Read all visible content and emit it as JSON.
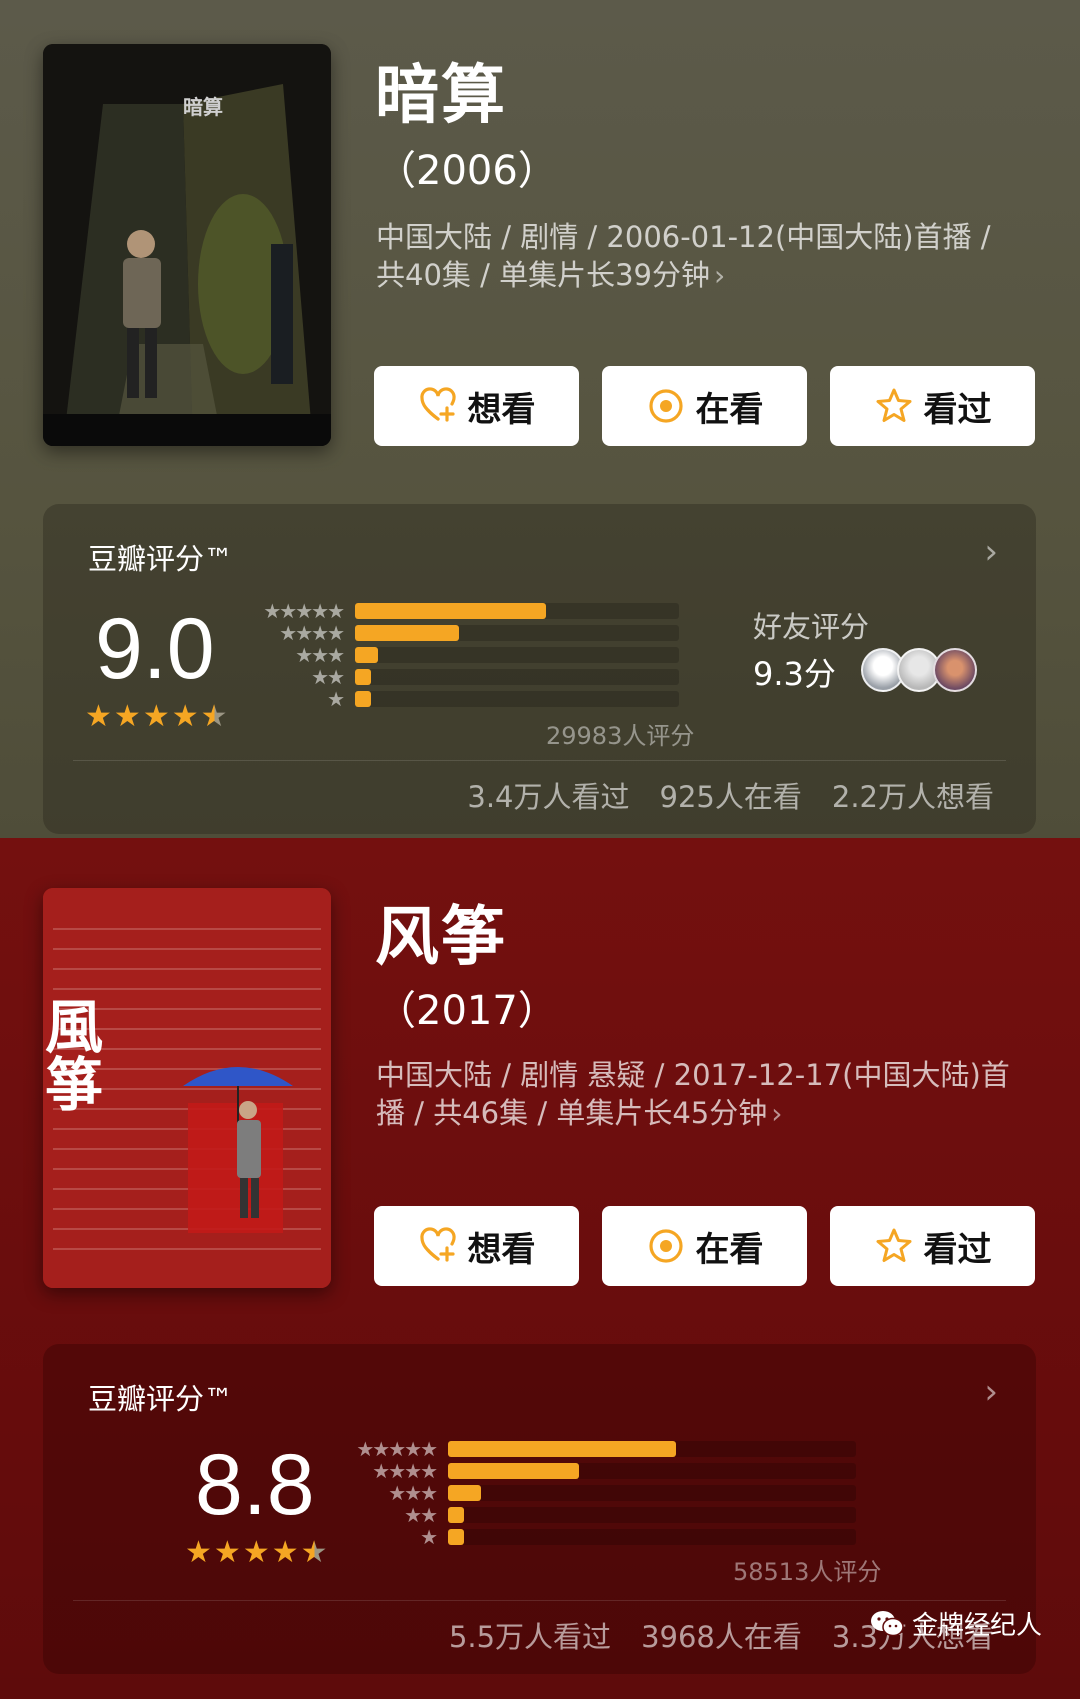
{
  "shows": [
    {
      "title": "暗算",
      "year": "（2006）",
      "meta": "中国大陆 / 剧情 / 2006-01-12(中国大陆)首播 / 共40集 / 单集片长39分钟",
      "poster_title": "暗算",
      "actions": {
        "want": "想看",
        "watching": "在看",
        "watched": "看过"
      },
      "rating": {
        "label": "豆瓣评分™",
        "score": "9.0",
        "stars": 4.5,
        "distribution": [
          0.59,
          0.32,
          0.07,
          0.05,
          0.05
        ],
        "count": "29983人评分",
        "friends_label": "好友评分",
        "friends_score": "9.3分",
        "stats": {
          "watched": "3.4万人看过",
          "watching": "925人在看",
          "want": "2.2万人想看"
        }
      }
    },
    {
      "title": "风筝",
      "year": "（2017）",
      "meta": "中国大陆 / 剧情 悬疑 / 2017-12-17(中国大陆)首播 / 共46集 / 单集片长45分钟",
      "poster_title": "風箏",
      "actions": {
        "want": "想看",
        "watching": "在看",
        "watched": "看过"
      },
      "rating": {
        "label": "豆瓣评分™",
        "score": "8.8",
        "stars": 4.5,
        "distribution": [
          0.56,
          0.32,
          0.08,
          0.04,
          0.04
        ],
        "count": "58513人评分",
        "stats": {
          "watched": "5.5万人看过",
          "watching": "3968人在看",
          "want": "3.3万人想看"
        }
      }
    }
  ],
  "watermark": "金牌经纪人",
  "colors": {
    "accent": "#f5a623",
    "section1_bg": "#56543f",
    "section2_bg": "#6a0d0d"
  }
}
